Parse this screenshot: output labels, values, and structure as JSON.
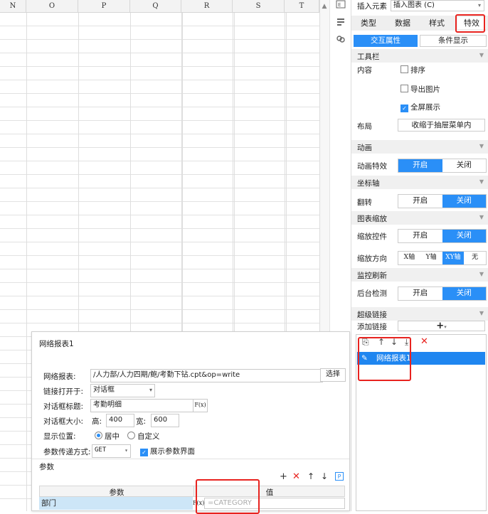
{
  "sheet": {
    "columns": [
      "N",
      "O",
      "P",
      "Q",
      "R",
      "S",
      "T"
    ]
  },
  "right_panel": {
    "insert_label": "插入元素",
    "insert_value": "插入图表 (C)",
    "tabs": [
      "类型",
      "数据",
      "样式",
      "特效"
    ],
    "subtabs": [
      "交互属性",
      "条件显示"
    ],
    "toolbar": {
      "title": "工具栏",
      "content_label": "内容",
      "sort_label": "排序",
      "export_image_label": "导出图片",
      "fullscreen_label": "全屏展示",
      "layout_label": "布局",
      "layout_value": "收缩于抽屉菜单内"
    },
    "animation": {
      "title": "动画",
      "effect_label": "动画特效",
      "on": "开启",
      "off": "关闭"
    },
    "axis": {
      "title": "坐标轴",
      "flip_label": "翻转",
      "on": "开启",
      "off": "关闭"
    },
    "zoom": {
      "title": "图表缩放",
      "control_label": "缩放控件",
      "on": "开启",
      "off": "关闭",
      "direction_label": "缩放方向",
      "directions": [
        "X轴",
        "Y轴",
        "XY轴",
        "无"
      ]
    },
    "monitor": {
      "title": "监控刷新",
      "backend_label": "后台检测",
      "on": "开启",
      "off": "关闭"
    },
    "hyperlink": {
      "title": "超级链接",
      "add_label": "添加链接",
      "add_symbol": "+",
      "item": "网络报表1"
    }
  },
  "dialog": {
    "title": "网络报表1",
    "report_label": "网络报表:",
    "report_value": "/人力部/人力四期/鲍/考勤下钻.cpt&op=write",
    "choose_label": "选择",
    "open_in_label": "链接打开于:",
    "open_in_value": "对话框",
    "dialog_title_label": "对话框标题:",
    "dialog_title_value": "考勤明细",
    "formula_btn": "F(x)",
    "size_label": "对话框大小:",
    "height_label": "高:",
    "height_value": "400",
    "width_label": "宽:",
    "width_value": "600",
    "position_label": "显示位置:",
    "position_center": "居中",
    "position_custom": "自定义",
    "param_method_label": "参数传递方式:",
    "param_method_value": "GET",
    "show_param_label": "展示参数界面",
    "params_title": "参数",
    "col_param": "参数",
    "col_value": "值",
    "rows": [
      {
        "param": "部门",
        "value": "=CATEGORY"
      }
    ]
  },
  "colors": {
    "accent": "#2a8ff7",
    "highlight": "#e8231f",
    "selected_row": "#1f86f0"
  }
}
